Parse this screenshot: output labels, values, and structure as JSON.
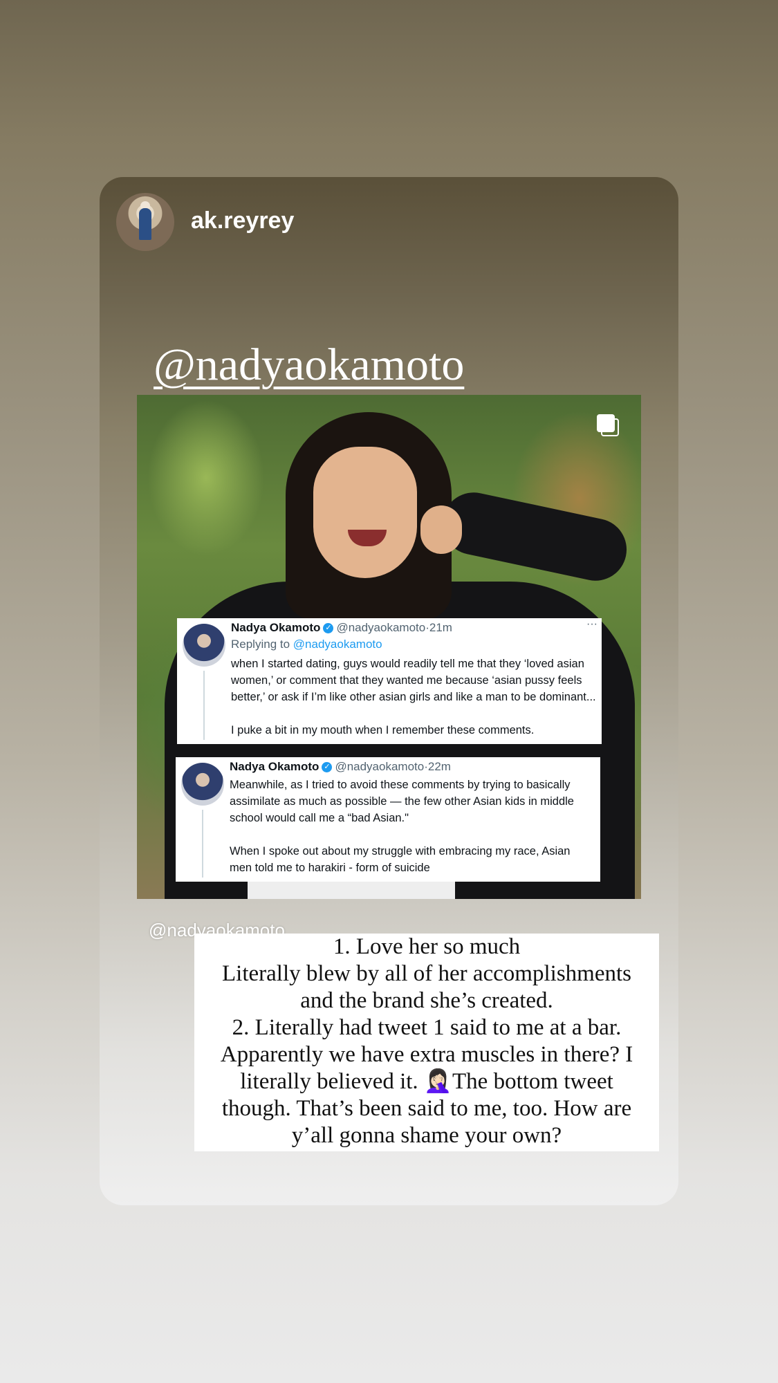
{
  "story": {
    "username": "ak.reyrey",
    "mention_title": "@nadyaokamoto",
    "mention_small": "@nadyaokamoto"
  },
  "tweets": [
    {
      "name": "Nadya Okamoto",
      "verified_icon": "verified-badge-icon",
      "handle": "@nadyaokamoto",
      "time": "21m",
      "replying_prefix": "Replying to",
      "replying_handle": "@nadyaokamoto",
      "paragraphs": [
        "when I started dating, guys would readily tell me that they ‘loved asian women,’ or comment that they wanted me because ‘asian pussy feels better,’ or ask if I’m like other asian girls and like a man to be dominant...",
        "I puke a bit in my mouth when I remember these comments."
      ]
    },
    {
      "name": "Nadya Okamoto",
      "verified_icon": "verified-badge-icon",
      "handle": "@nadyaokamoto",
      "time": "22m",
      "paragraphs": [
        "Meanwhile, as I tried to avoid these comments by trying to basically assimilate as much as possible — the few other Asian kids in middle school would call me a “bad Asian.\"",
        "When I spoke out about my struggle with embracing my race, Asian men told me to harakiri - form of suicide"
      ]
    }
  ],
  "caption": {
    "lines": [
      "1. Love her so much",
      "Literally blew by all of her accomplishments",
      "and the brand she’s created.",
      "2. Literally had tweet 1 said to me at a bar.",
      "Apparently we have extra muscles in there? I",
      "literally believed it. 🤦🏻‍♀️The bottom tweet",
      "though. That’s been said to me, too. How are",
      "y’all gonna shame your own?"
    ]
  },
  "icons": {
    "multiple_images": "carousel-icon",
    "verified": "verified-badge-icon"
  },
  "colors": {
    "verified_blue": "#1d9bf0",
    "handle_gray": "#536471"
  }
}
